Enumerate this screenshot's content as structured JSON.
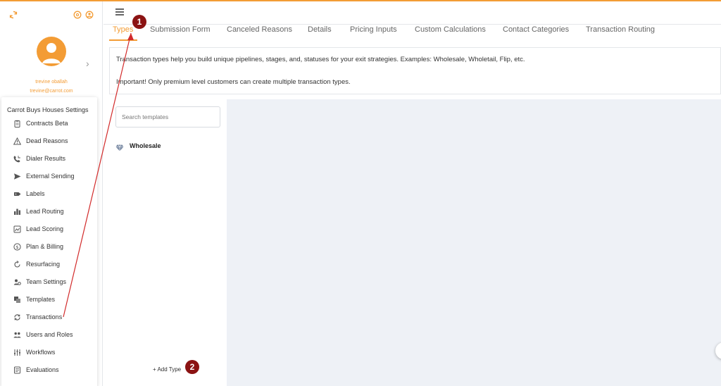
{
  "colors": {
    "accent": "#f39c35",
    "annotation": "#8b1313",
    "arrow": "#d22b2b"
  },
  "sidebar": {
    "icons": [
      "sync-icon",
      "help-icon",
      "account-icon"
    ],
    "user": {
      "name": "trevine oballah",
      "email": "trevine@carrot.com"
    },
    "settings_title": "Carrot Buys Houses Settings",
    "items": [
      {
        "label": "Contracts Beta",
        "icon": "clipboard-icon"
      },
      {
        "label": "Dead Reasons",
        "icon": "warning-icon"
      },
      {
        "label": "Dialer Results",
        "icon": "phone-icon"
      },
      {
        "label": "External Sending",
        "icon": "send-icon"
      },
      {
        "label": "Labels",
        "icon": "label-icon"
      },
      {
        "label": "Lead Routing",
        "icon": "bar-chart-icon"
      },
      {
        "label": "Lead Scoring",
        "icon": "scoring-icon"
      },
      {
        "label": "Plan & Billing",
        "icon": "dollar-icon"
      },
      {
        "label": "Resurfacing",
        "icon": "refresh-icon"
      },
      {
        "label": "Team Settings",
        "icon": "team-icon"
      },
      {
        "label": "Templates",
        "icon": "templates-icon"
      },
      {
        "label": "Transactions",
        "icon": "transactions-icon"
      },
      {
        "label": "Users and Roles",
        "icon": "users-icon"
      },
      {
        "label": "Workflows",
        "icon": "workflow-icon"
      },
      {
        "label": "Evaluations",
        "icon": "evaluations-icon"
      }
    ]
  },
  "tabs": [
    {
      "label": "Types",
      "active": true
    },
    {
      "label": "Submission Form"
    },
    {
      "label": "Canceled Reasons"
    },
    {
      "label": "Details"
    },
    {
      "label": "Pricing Inputs"
    },
    {
      "label": "Custom Calculations"
    },
    {
      "label": "Contact Categories"
    },
    {
      "label": "Transaction Routing"
    }
  ],
  "info": {
    "line1": "Transaction types help you build unique pipelines, stages, and, statuses for your exit strategies. Examples: Wholesale, Wholetail, Flip, etc.",
    "line2": "Important! Only premium level customers can create multiple transaction types."
  },
  "templates": {
    "search_placeholder": "Search templates",
    "search_value": "",
    "items": [
      {
        "label": "Wholesale",
        "icon": "diamond-icon"
      }
    ],
    "add_label": "+ Add Type"
  },
  "annotations": [
    {
      "label": "1"
    },
    {
      "label": "2"
    }
  ]
}
